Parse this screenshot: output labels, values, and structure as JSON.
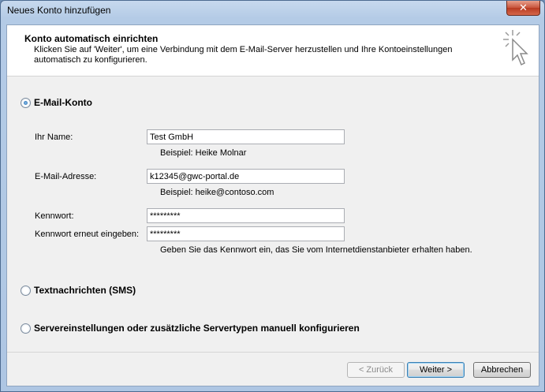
{
  "window": {
    "title": "Neues Konto hinzufügen",
    "close_glyph": "✕"
  },
  "header": {
    "title": "Konto automatisch einrichten",
    "description": "Klicken Sie auf 'Weiter', um eine Verbindung mit dem E-Mail-Server herzustellen und Ihre Kontoeinstellungen automatisch zu konfigurieren.",
    "icon": "cursor-click-icon"
  },
  "options": {
    "email_account": {
      "label": "E-Mail-Konto",
      "selected": true
    },
    "sms": {
      "label": "Textnachrichten (SMS)",
      "selected": false
    },
    "manual": {
      "label": "Servereinstellungen oder zusätzliche Servertypen manuell konfigurieren",
      "selected": false
    }
  },
  "form": {
    "name": {
      "label": "Ihr Name:",
      "value": "Test GmbH",
      "hint": "Beispiel: Heike Molnar"
    },
    "email": {
      "label": "E-Mail-Adresse:",
      "value": "k12345@gwc-portal.de",
      "hint": "Beispiel: heike@contoso.com"
    },
    "password": {
      "label": "Kennwort:",
      "value": "*********"
    },
    "password_repeat": {
      "label": "Kennwort erneut eingeben:",
      "value": "*********",
      "hint": "Geben Sie das Kennwort ein, das Sie vom Internetdienstanbieter erhalten haben."
    }
  },
  "buttons": {
    "back": "< Zurück",
    "next": "Weiter >",
    "cancel": "Abbrechen"
  }
}
